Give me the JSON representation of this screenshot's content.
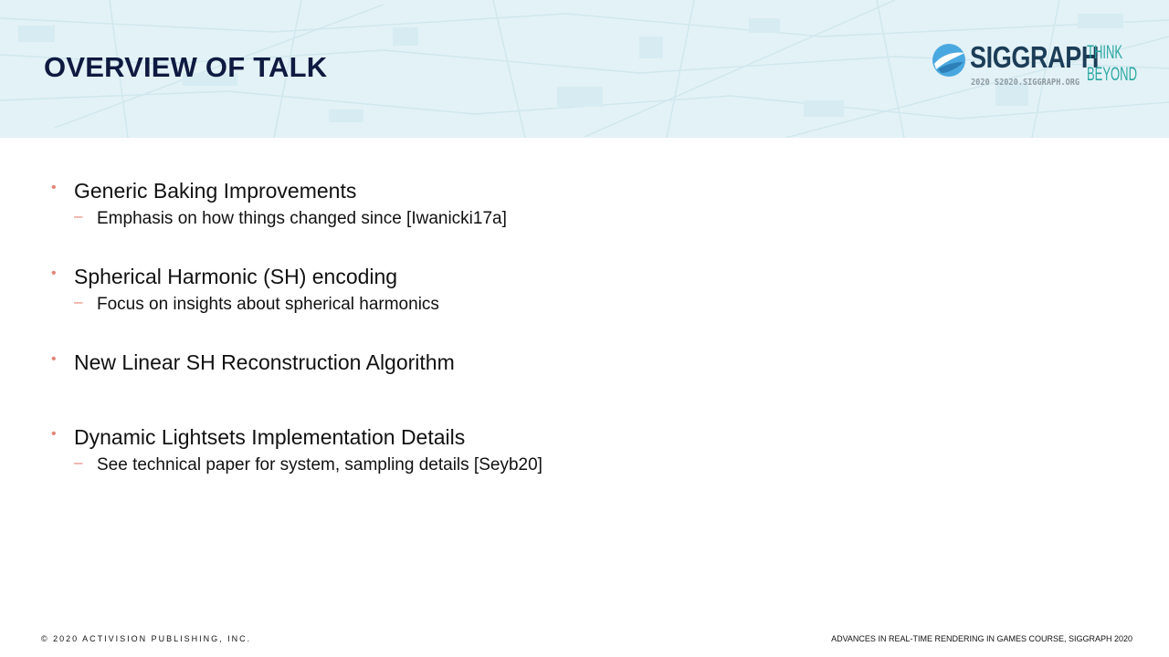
{
  "slide": {
    "title": "OVERVIEW OF TALK"
  },
  "logo": {
    "wordmark": "SIGGRAPH",
    "subtitle": "2020  S2020.SIGGRAPH.ORG",
    "tagline_line1": "THINK",
    "tagline_line2": "BEYOND",
    "colors": {
      "wordmark": "#1c3d57",
      "tagline": "#2aa7a3",
      "mark": "#4aa8e0"
    }
  },
  "bullets": [
    {
      "text": "Generic Baking Improvements",
      "sub": "Emphasis on how things changed since [Iwanicki17a]"
    },
    {
      "text": "Spherical Harmonic (SH) encoding",
      "sub": "Focus on insights about spherical harmonics"
    },
    {
      "text": "New Linear SH Reconstruction Algorithm"
    },
    {
      "text": "Dynamic Lightsets Implementation Details",
      "sub": "See technical paper for system, sampling details [Seyb20]"
    }
  ],
  "bullet_symbol": "•",
  "sub_symbol": "–",
  "footer": {
    "left": "© 2020 ACTIVISION PUBLISHING, INC.",
    "right": "ADVANCES IN REAL-TIME RENDERING IN GAMES COURSE, SIGGRAPH 2020"
  },
  "colors": {
    "header_bg": "#e3f2f6",
    "title": "#0e1a40",
    "bullet_accent": "#e4867a"
  }
}
